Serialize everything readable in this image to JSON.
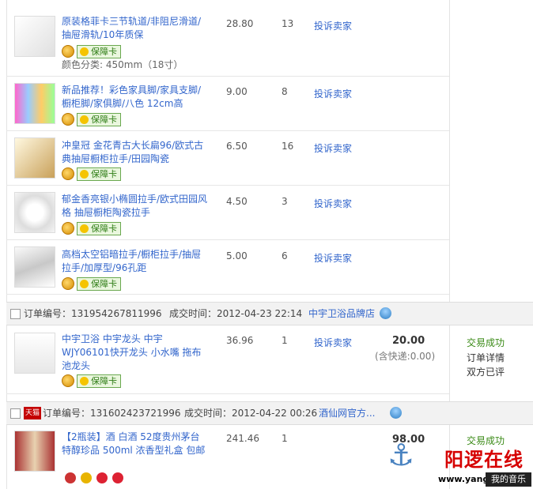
{
  "items": [
    {
      "title": "原装格菲卡三节轨道/非阻尼滑道/抽屉滑轨/10年质保",
      "sku": "颜色分类: 450mm（18寸）",
      "price": "28.80",
      "qty": "13",
      "complain": "投诉卖家",
      "badge": "保障卡"
    },
    {
      "title": "新品推荐！彩色家具脚/家具支脚/橱柜脚/家俱脚/八色 12cm高",
      "price": "9.00",
      "qty": "8",
      "complain": "投诉卖家",
      "badge": "保障卡"
    },
    {
      "title": "冲皇冠 金花青古大长扁96/欧式古典抽屉橱柜拉手/田园陶瓷",
      "price": "6.50",
      "qty": "16",
      "complain": "投诉卖家",
      "badge": "保障卡"
    },
    {
      "title": "郁金香亮银小椭圆拉手/欧式田园风格 抽屉橱柜陶瓷拉手",
      "price": "4.50",
      "qty": "3",
      "complain": "投诉卖家",
      "badge": "保障卡"
    },
    {
      "title": "高档太空铝暗拉手/橱柜拉手/抽屉拉手/加厚型/96孔距",
      "price": "5.00",
      "qty": "6",
      "complain": "投诉卖家",
      "badge": "保障卡"
    }
  ],
  "orders": [
    {
      "order_label": "订单编号：131954267811996",
      "deal_label": "成交时间：2012-04-23 22:14",
      "shop": "中宇卫浴品牌店",
      "item": {
        "title": "中宇卫浴 中宇龙头 中宇WJY06101快开龙头 小水嘴 拖布池龙头",
        "price": "36.96",
        "qty": "1",
        "complain": "投诉卖家",
        "badge": "保障卡"
      },
      "total": "20.00",
      "shipping": "(含快递:0.00)",
      "status": [
        "交易成功",
        "订单详情",
        "双方已评"
      ]
    },
    {
      "tmall": "天猫",
      "order_label": "订单编号：131602423721996",
      "deal_label": "成交时间：2012-04-22 00:26",
      "shop": "酒仙网官方...",
      "item": {
        "title": "【2瓶装】酒 白酒 52度贵州茅台特醇珍品 500ml 浓香型礼盒 包邮",
        "price": "241.46",
        "qty": "1"
      },
      "total": "98.00",
      "status": [
        "交易成功"
      ]
    }
  ],
  "watermark": {
    "text": "阳逻在线",
    "url": "www.yangluo.cn",
    "mini": "我的音乐"
  }
}
